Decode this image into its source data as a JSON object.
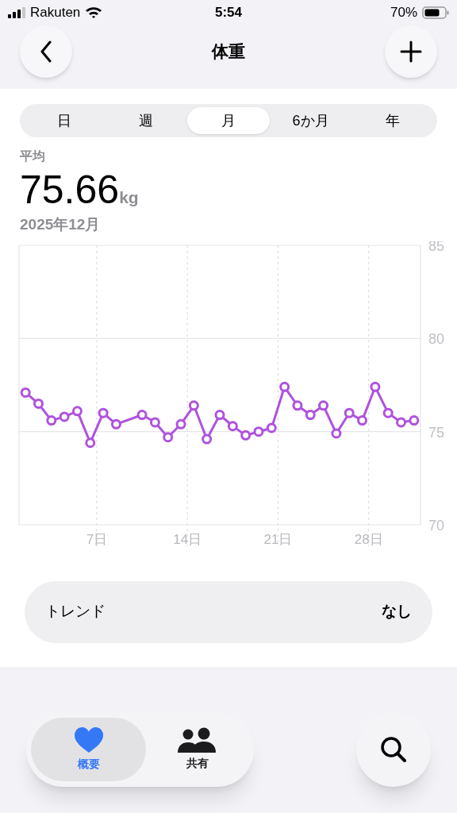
{
  "status_bar": {
    "carrier": "Rakuten",
    "time": "5:54",
    "battery": "70%"
  },
  "nav": {
    "title": "体重"
  },
  "segments": [
    {
      "label": "日",
      "selected": false
    },
    {
      "label": "週",
      "selected": false
    },
    {
      "label": "月",
      "selected": true
    },
    {
      "label": "6か月",
      "selected": false
    },
    {
      "label": "年",
      "selected": false
    }
  ],
  "summary": {
    "label": "平均",
    "value": "75.66",
    "unit": "kg",
    "period": "2025年12月"
  },
  "chart_data": {
    "type": "line",
    "grid": true,
    "xlim": [
      1,
      32
    ],
    "ylim": [
      70,
      85
    ],
    "xticks": [
      {
        "value": 7,
        "label": "7日"
      },
      {
        "value": 14,
        "label": "14日"
      },
      {
        "value": 21,
        "label": "21日"
      },
      {
        "value": 28,
        "label": "28日"
      }
    ],
    "yticks": [
      70,
      75,
      80,
      85
    ],
    "x": [
      1.5,
      2.5,
      3.5,
      4.5,
      5.5,
      6.5,
      7.5,
      8.5,
      10.5,
      11.5,
      12.5,
      13.5,
      14.5,
      15.5,
      16.5,
      17.5,
      18.5,
      19.5,
      20.5,
      21.5,
      22.5,
      23.5,
      24.5,
      25.5,
      26.5,
      27.5,
      28.5,
      29.5,
      30.5,
      31.5
    ],
    "series": [
      {
        "color": "#af52de",
        "marker": "circle",
        "values": [
          77.1,
          76.5,
          75.6,
          75.8,
          76.1,
          74.4,
          76.0,
          75.4,
          75.9,
          75.5,
          74.7,
          75.4,
          76.4,
          74.6,
          75.9,
          75.3,
          74.8,
          75.0,
          75.2,
          77.4,
          76.4,
          75.9,
          76.4,
          74.9,
          76.0,
          75.6,
          77.4,
          76.0,
          75.5,
          75.6
        ]
      }
    ]
  },
  "trend": {
    "label": "トレンド",
    "value": "なし"
  },
  "tab_bar": [
    {
      "label": "概要",
      "selected": true,
      "kind": "heart"
    },
    {
      "label": "共有",
      "selected": false,
      "kind": "people"
    }
  ]
}
